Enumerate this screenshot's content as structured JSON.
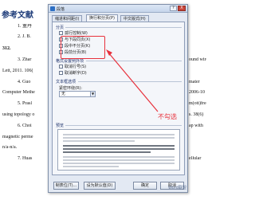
{
  "document": {
    "heading": "参考文献",
    "lines": [
      {
        "num": "1.",
        "text": "董丹"
      },
      {
        "num": "2.",
        "text": "J. B."
      },
      {
        "num": "",
        "text": "312."
      },
      {
        "num": "3.",
        "text": "Zhar"
      },
      {
        "num": "",
        "text": "Lett, 2011. 106("
      },
      {
        "num": "4.",
        "text": "Guo"
      },
      {
        "num": "",
        "text": "Computer Methe"
      },
      {
        "num": "5.",
        "text": "Prasl"
      },
      {
        "num": "",
        "text": "using topology o"
      },
      {
        "num": "6.",
        "text": "Choi"
      },
      {
        "num": "",
        "text": "magnetic perme"
      },
      {
        "num": "",
        "text": "n/a-n/a."
      },
      {
        "num": "7.",
        "text": "Huas"
      }
    ],
    "right_fragments": [
      "ound wire",
      "mater",
      "2006-10",
      "m(ott)free",
      "s. 38(6)",
      "ap with",
      "ellular"
    ]
  },
  "dialog": {
    "title": "段落",
    "help": "?",
    "close": "X",
    "tabs": [
      "缩进和间距(I)",
      "换行和分页(P)",
      "中文版式(H)"
    ],
    "active_tab": 1,
    "pagination_label": "分页",
    "pagination_options": [
      {
        "label": "孤行控制(W)",
        "checked": false
      },
      {
        "label": "与下段同页(X)",
        "checked": false
      },
      {
        "label": "段中不分页(K)",
        "checked": false
      },
      {
        "label": "段前分页(B)",
        "checked": false
      }
    ],
    "format_label": "格式设置例外项",
    "format_options": [
      {
        "label": "取消行号(S)",
        "checked": false
      },
      {
        "label": "取消断字(D)",
        "checked": false
      }
    ],
    "textbox_label": "文本框选项",
    "wrap_label": "紧密环绕(R):",
    "wrap_value": "无",
    "preview_label": "预览",
    "buttons": {
      "tabs": "制表位(T)...",
      "default": "设为默认值(D)",
      "ok": "确定",
      "cancel": "取消"
    }
  },
  "annotation": {
    "text": "不勾选",
    "color": "#e8313c"
  },
  "watermark": "Word联盟"
}
